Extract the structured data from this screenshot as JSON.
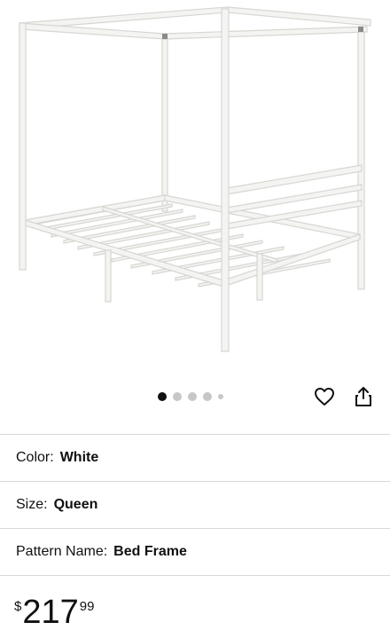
{
  "product": {
    "image_alt": "white metal canopy bed frame",
    "gallery": {
      "count": 5,
      "active_index": 0
    }
  },
  "actions": {
    "wishlist_icon": "heart-icon",
    "share_icon": "share-icon"
  },
  "variations": [
    {
      "label": "Color:",
      "value": "White"
    },
    {
      "label": "Size:",
      "value": "Queen"
    },
    {
      "label": "Pattern Name:",
      "value": "Bed Frame"
    }
  ],
  "price": {
    "symbol": "$",
    "whole": "217",
    "fraction": "99"
  },
  "colors": {
    "text": "#0f1111",
    "divider": "#d5d9d9",
    "frame": "#f4f4f2",
    "frame_stroke": "#d6d6d2"
  }
}
